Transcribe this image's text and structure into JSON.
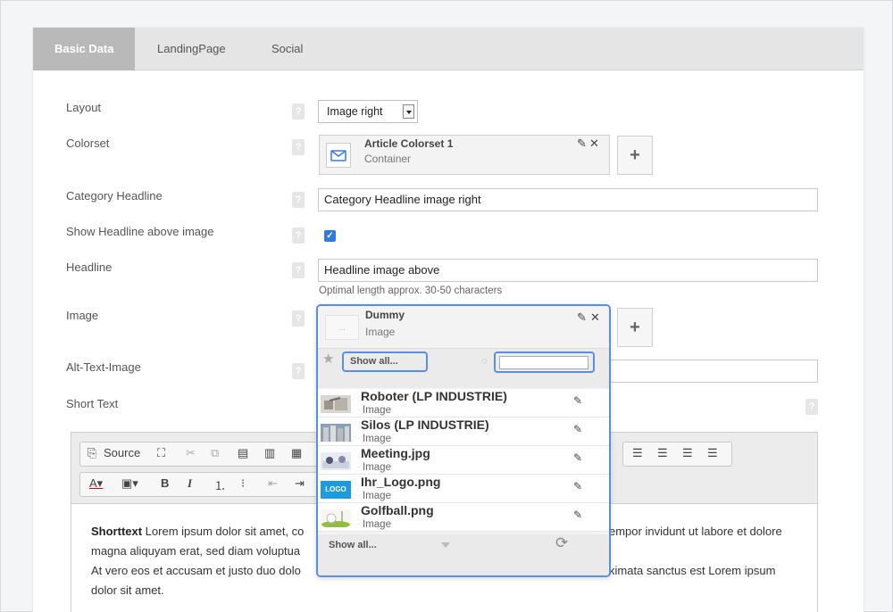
{
  "tabs": [
    {
      "label": "Basic Data",
      "active": true
    },
    {
      "label": "LandingPage",
      "active": false
    },
    {
      "label": "Social",
      "active": false
    }
  ],
  "form": {
    "help_glyph": "?",
    "layout": {
      "label": "Layout",
      "value": "Image right"
    },
    "colorset": {
      "label": "Colorset",
      "card_title": "Article Colorset 1",
      "card_sub": "Container"
    },
    "category_headline": {
      "label": "Category Headline",
      "value": "Category Headline image right"
    },
    "show_headline": {
      "label": "Show Headline above image",
      "checked": true
    },
    "headline": {
      "label": "Headline",
      "value": "Headline image above",
      "hint": "Optimal length approx. 30-50 characters"
    },
    "image": {
      "label": "Image",
      "card_title": "Dummy",
      "card_sub": "Image",
      "thumb_text": "..."
    },
    "alt_text": {
      "label": "Alt-Text-Image",
      "value": ""
    },
    "short_text": {
      "label": "Short Text"
    }
  },
  "icons": {
    "edit": "✎",
    "close": "✕",
    "add": "+",
    "star": "★",
    "search": "⚲",
    "refresh": "⟳",
    "check": "✓"
  },
  "editor": {
    "toolbar": {
      "source_label": "Source",
      "row1": [
        "maximize-icon",
        "cut-icon",
        "copy-icon",
        "paste-icon",
        "paste-text-icon",
        "paste-word-icon"
      ],
      "align": [
        "align-left-icon",
        "align-center-icon",
        "align-right-icon",
        "align-justify-icon"
      ],
      "row2": [
        "text-color-icon",
        "bg-color-icon",
        "bold-icon",
        "italic-icon",
        "numbered-list-icon",
        "bullet-list-icon",
        "outdent-icon",
        "indent-icon"
      ]
    },
    "content": {
      "bold_lead": "Shorttext",
      "line1_left": " Lorem ipsum dolor sit amet, co",
      "line1_right": "empor invidunt ut labore et dolore",
      "line2_left": "magna aliquyam erat, sed diam voluptua",
      "line3_left": "At vero eos et accusam et justo duo dolo",
      "line3_right": "kimata sanctus est Lorem ipsum",
      "line4_left": "dolor sit amet."
    }
  },
  "dropdown": {
    "show_all_top": "Show all...",
    "search_placeholder": "",
    "items": [
      {
        "name": "Roboter (LP INDUSTRIE)",
        "type": "Image",
        "thumb": "robot"
      },
      {
        "name": "Silos (LP INDUSTRIE)",
        "type": "Image",
        "thumb": "silos"
      },
      {
        "name": "Meeting.jpg",
        "type": "Image",
        "thumb": "meeting"
      },
      {
        "name": "Ihr_Logo.png",
        "type": "Image",
        "thumb": "logo",
        "thumb_text": "LOGO"
      },
      {
        "name": "Golfball.png",
        "type": "Image",
        "thumb": "golf"
      }
    ],
    "show_all_bottom": "Show all..."
  }
}
